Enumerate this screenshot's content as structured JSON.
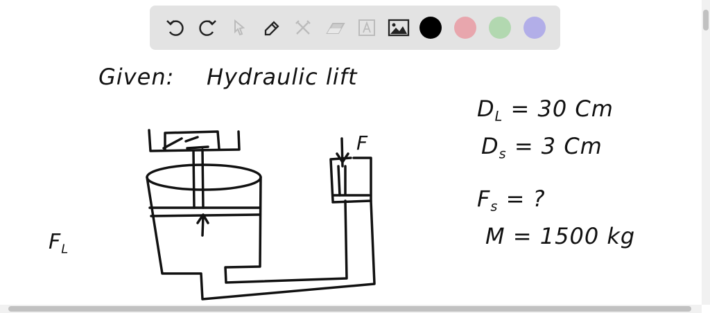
{
  "toolbar": {
    "tools": [
      "undo-icon",
      "redo-icon",
      "select-icon",
      "pen-icon",
      "tools-icon",
      "eraser-icon",
      "text-icon",
      "image-icon"
    ],
    "colors": [
      "#000000",
      "#e8a6ad",
      "#b2d8b0",
      "#b2aee8"
    ]
  },
  "board": {
    "given": "Given:",
    "title": "Hydraulic lift",
    "dl_label": "D",
    "dl_sub": "L",
    "dl_value": "= 30 Cm",
    "ds_label": "D",
    "ds_sub": "s",
    "ds_value": "= 3 Cm",
    "fs_label": "F",
    "fs_sub": "s",
    "fs_value": "= ?",
    "mass": "M = 1500 kg",
    "force_small": "F",
    "force_large": "F",
    "force_large_sub": "L"
  }
}
